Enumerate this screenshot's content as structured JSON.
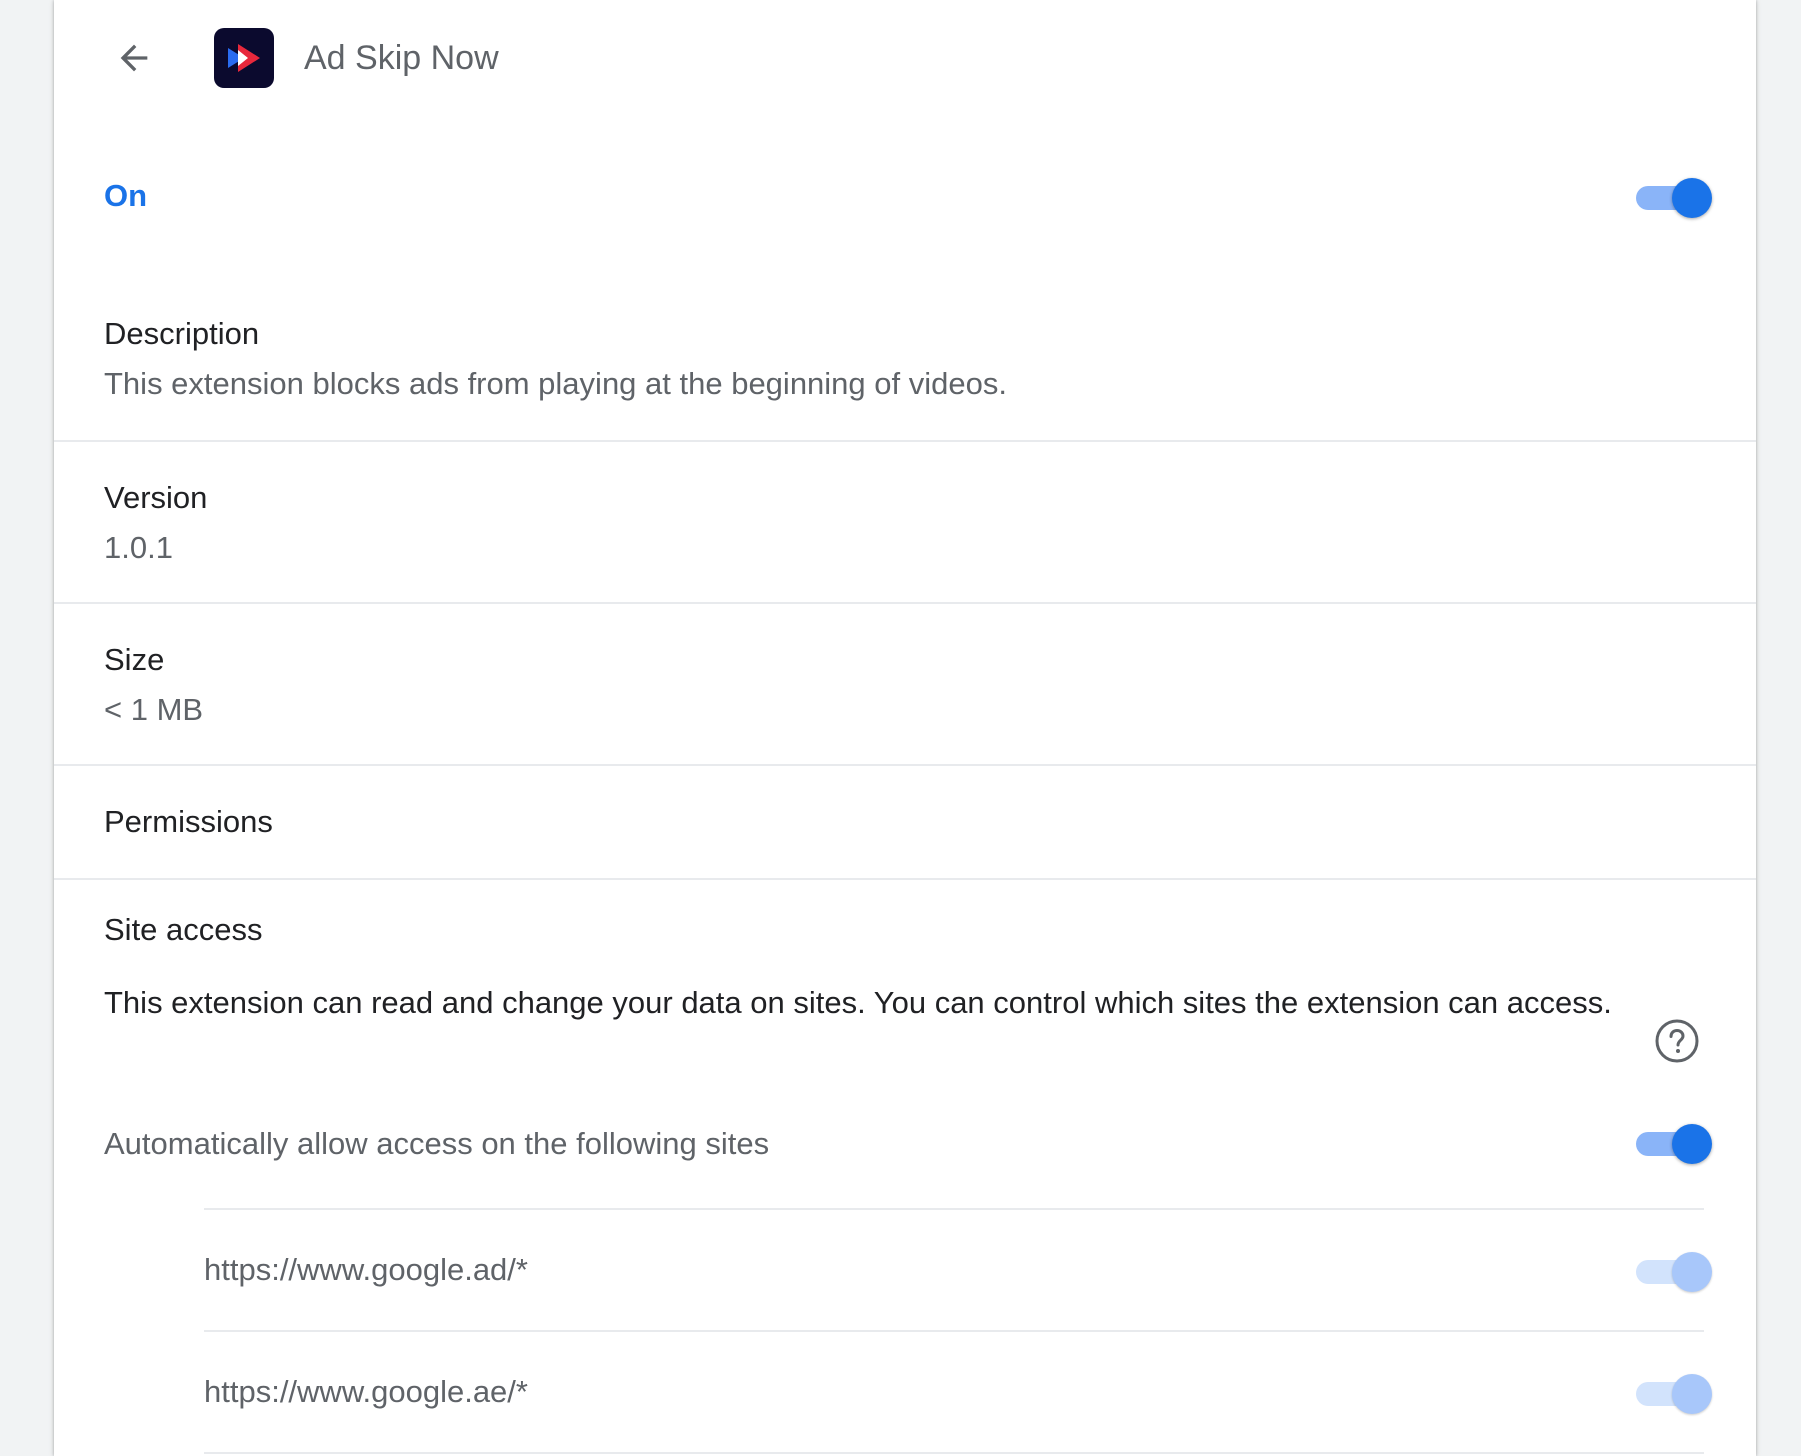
{
  "extension": {
    "name": "Ad Skip Now",
    "status_label": "On",
    "enabled": true
  },
  "details": {
    "description_label": "Description",
    "description_text": "This extension blocks ads from playing at the beginning of videos.",
    "version_label": "Version",
    "version_value": "1.0.1",
    "size_label": "Size",
    "size_value": "< 1 MB",
    "permissions_label": "Permissions"
  },
  "site_access": {
    "title": "Site access",
    "description": "This extension can read and change your data on sites. You can control which sites the extension can access.",
    "auto_allow_label": "Automatically allow access on the following sites",
    "auto_allow_enabled": true,
    "sites": [
      {
        "url": "https://www.google.ad/*",
        "enabled": true
      },
      {
        "url": "https://www.google.ae/*",
        "enabled": true
      }
    ]
  },
  "icons": {
    "back": "arrow-back-icon",
    "help": "help-circle-icon",
    "app": "ad-skip-now-app-icon"
  },
  "colors": {
    "accent": "#1a73e8",
    "toggle_track": "#8ab4f8",
    "toggle_disabled_track": "#d2e3fc",
    "toggle_disabled_knob": "#a8c7fa",
    "secondary_text": "#5f6368",
    "divider": "#e8eaed"
  }
}
